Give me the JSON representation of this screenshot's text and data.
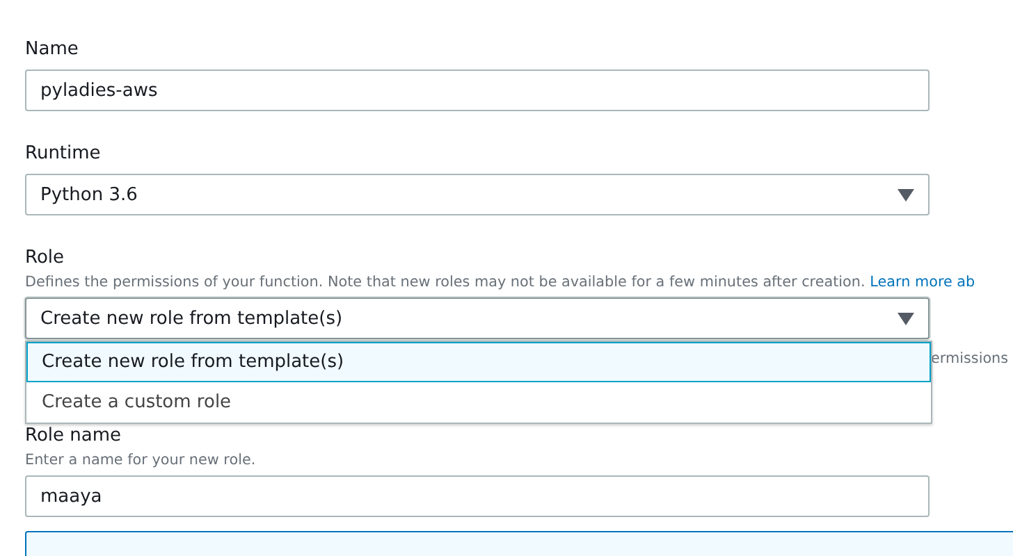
{
  "fields": [
    {
      "kind": "input",
      "label": "Name",
      "value": "pyladies-aws"
    },
    {
      "kind": "select",
      "label": "Runtime",
      "value": "Python 3.6"
    },
    {
      "kind": "select",
      "label": "Role",
      "description": "Defines the permissions of your function. Note that new roles may not be available for a few minutes after creation.",
      "link": "Learn more ab",
      "value": "Create new role from template(s)",
      "hint": "ermissions",
      "expanded": true,
      "options": [
        {
          "label": "Create new role from template(s)",
          "selected": true
        },
        {
          "label": "Create a custom role",
          "selected": false
        }
      ]
    },
    {
      "kind": "input",
      "label": "Role name",
      "description": "Enter a name for your new role.",
      "value": "maaya"
    }
  ],
  "panel": {
    "kind": "info"
  }
}
